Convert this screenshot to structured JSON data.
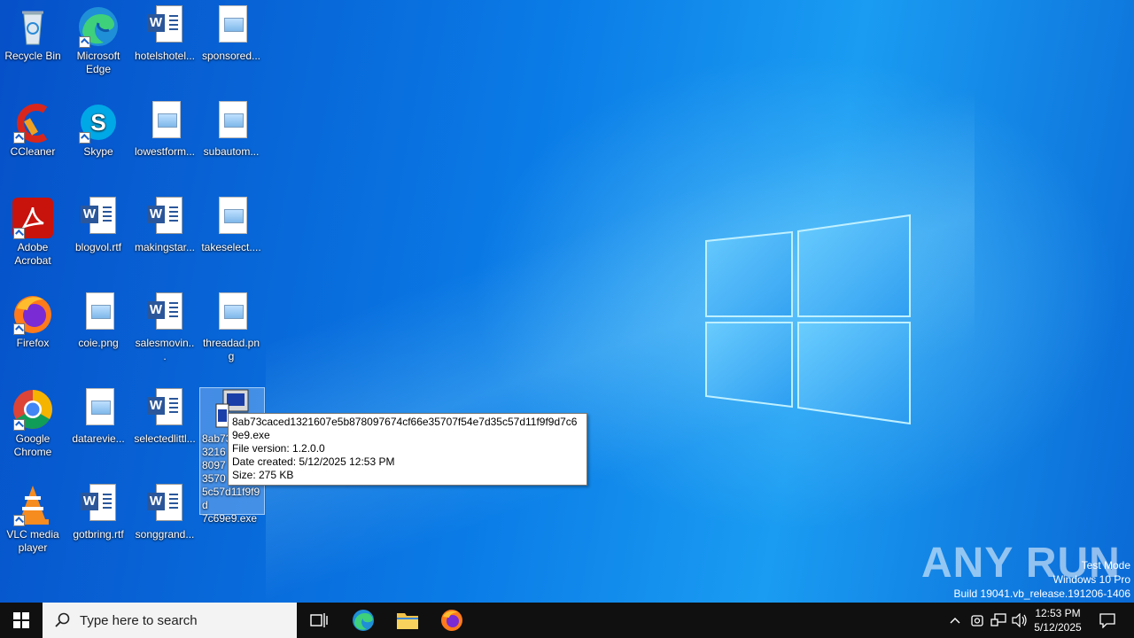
{
  "desktop": {
    "icons": [
      {
        "label": "Recycle Bin",
        "kind": "recycle-bin"
      },
      {
        "label": "Microsoft Edge",
        "kind": "edge"
      },
      {
        "label": "hotelshotel...",
        "kind": "word"
      },
      {
        "label": "sponsored...",
        "kind": "image"
      },
      {
        "label": "CCleaner",
        "kind": "ccleaner"
      },
      {
        "label": "Skype",
        "kind": "skype"
      },
      {
        "label": "lowestform...",
        "kind": "image"
      },
      {
        "label": "subautom...",
        "kind": "image"
      },
      {
        "label": "Adobe Acrobat",
        "kind": "acrobat"
      },
      {
        "label": "blogvol.rtf",
        "kind": "word"
      },
      {
        "label": "makingstar...",
        "kind": "word"
      },
      {
        "label": "takeselect....",
        "kind": "image"
      },
      {
        "label": "Firefox",
        "kind": "firefox"
      },
      {
        "label": "coie.png",
        "kind": "image"
      },
      {
        "label": "salesmovin...",
        "kind": "word"
      },
      {
        "label": "threadad.png",
        "kind": "image"
      },
      {
        "label": "Google Chrome",
        "kind": "chrome"
      },
      {
        "label": "datarevie...",
        "kind": "image"
      },
      {
        "label": "selectedlittl...",
        "kind": "word"
      },
      {
        "label": "8ab73caced1321607e5b878097674cf66e35707f54e7d35c57d11f9f9d7c69e9.exe",
        "kind": "exe"
      },
      {
        "label": "VLC media player",
        "kind": "vlc"
      },
      {
        "label": "gotbring.rtf",
        "kind": "word"
      },
      {
        "label": "songgrand...",
        "kind": "word"
      }
    ],
    "selected_partial_label": "8ab73ca\n3216\n8097\n3570\n5c57d11f9f9d\n7c69e9.exe"
  },
  "tooltip": {
    "name": "8ab73caced1321607e5b878097674cf66e35707f54e7d35c57d11f9f9d7c69e9.exe",
    "version": "File version: 1.2.0.0",
    "created": "Date created: 5/12/2025 12:53 PM",
    "size": "Size: 275 KB"
  },
  "watermark": {
    "brand": "ANY RUN",
    "line1": "Test Mode",
    "line2": "Windows 10 Pro",
    "line3": "Build 19041.vb_release.191206-1406"
  },
  "taskbar": {
    "search_placeholder": "Type here to search",
    "time": "12:53 PM",
    "date": "5/12/2025"
  },
  "colors": {
    "taskbar_bg": "#101010",
    "desktop_accent": "#0a7be6",
    "word_blue": "#2b579a"
  }
}
